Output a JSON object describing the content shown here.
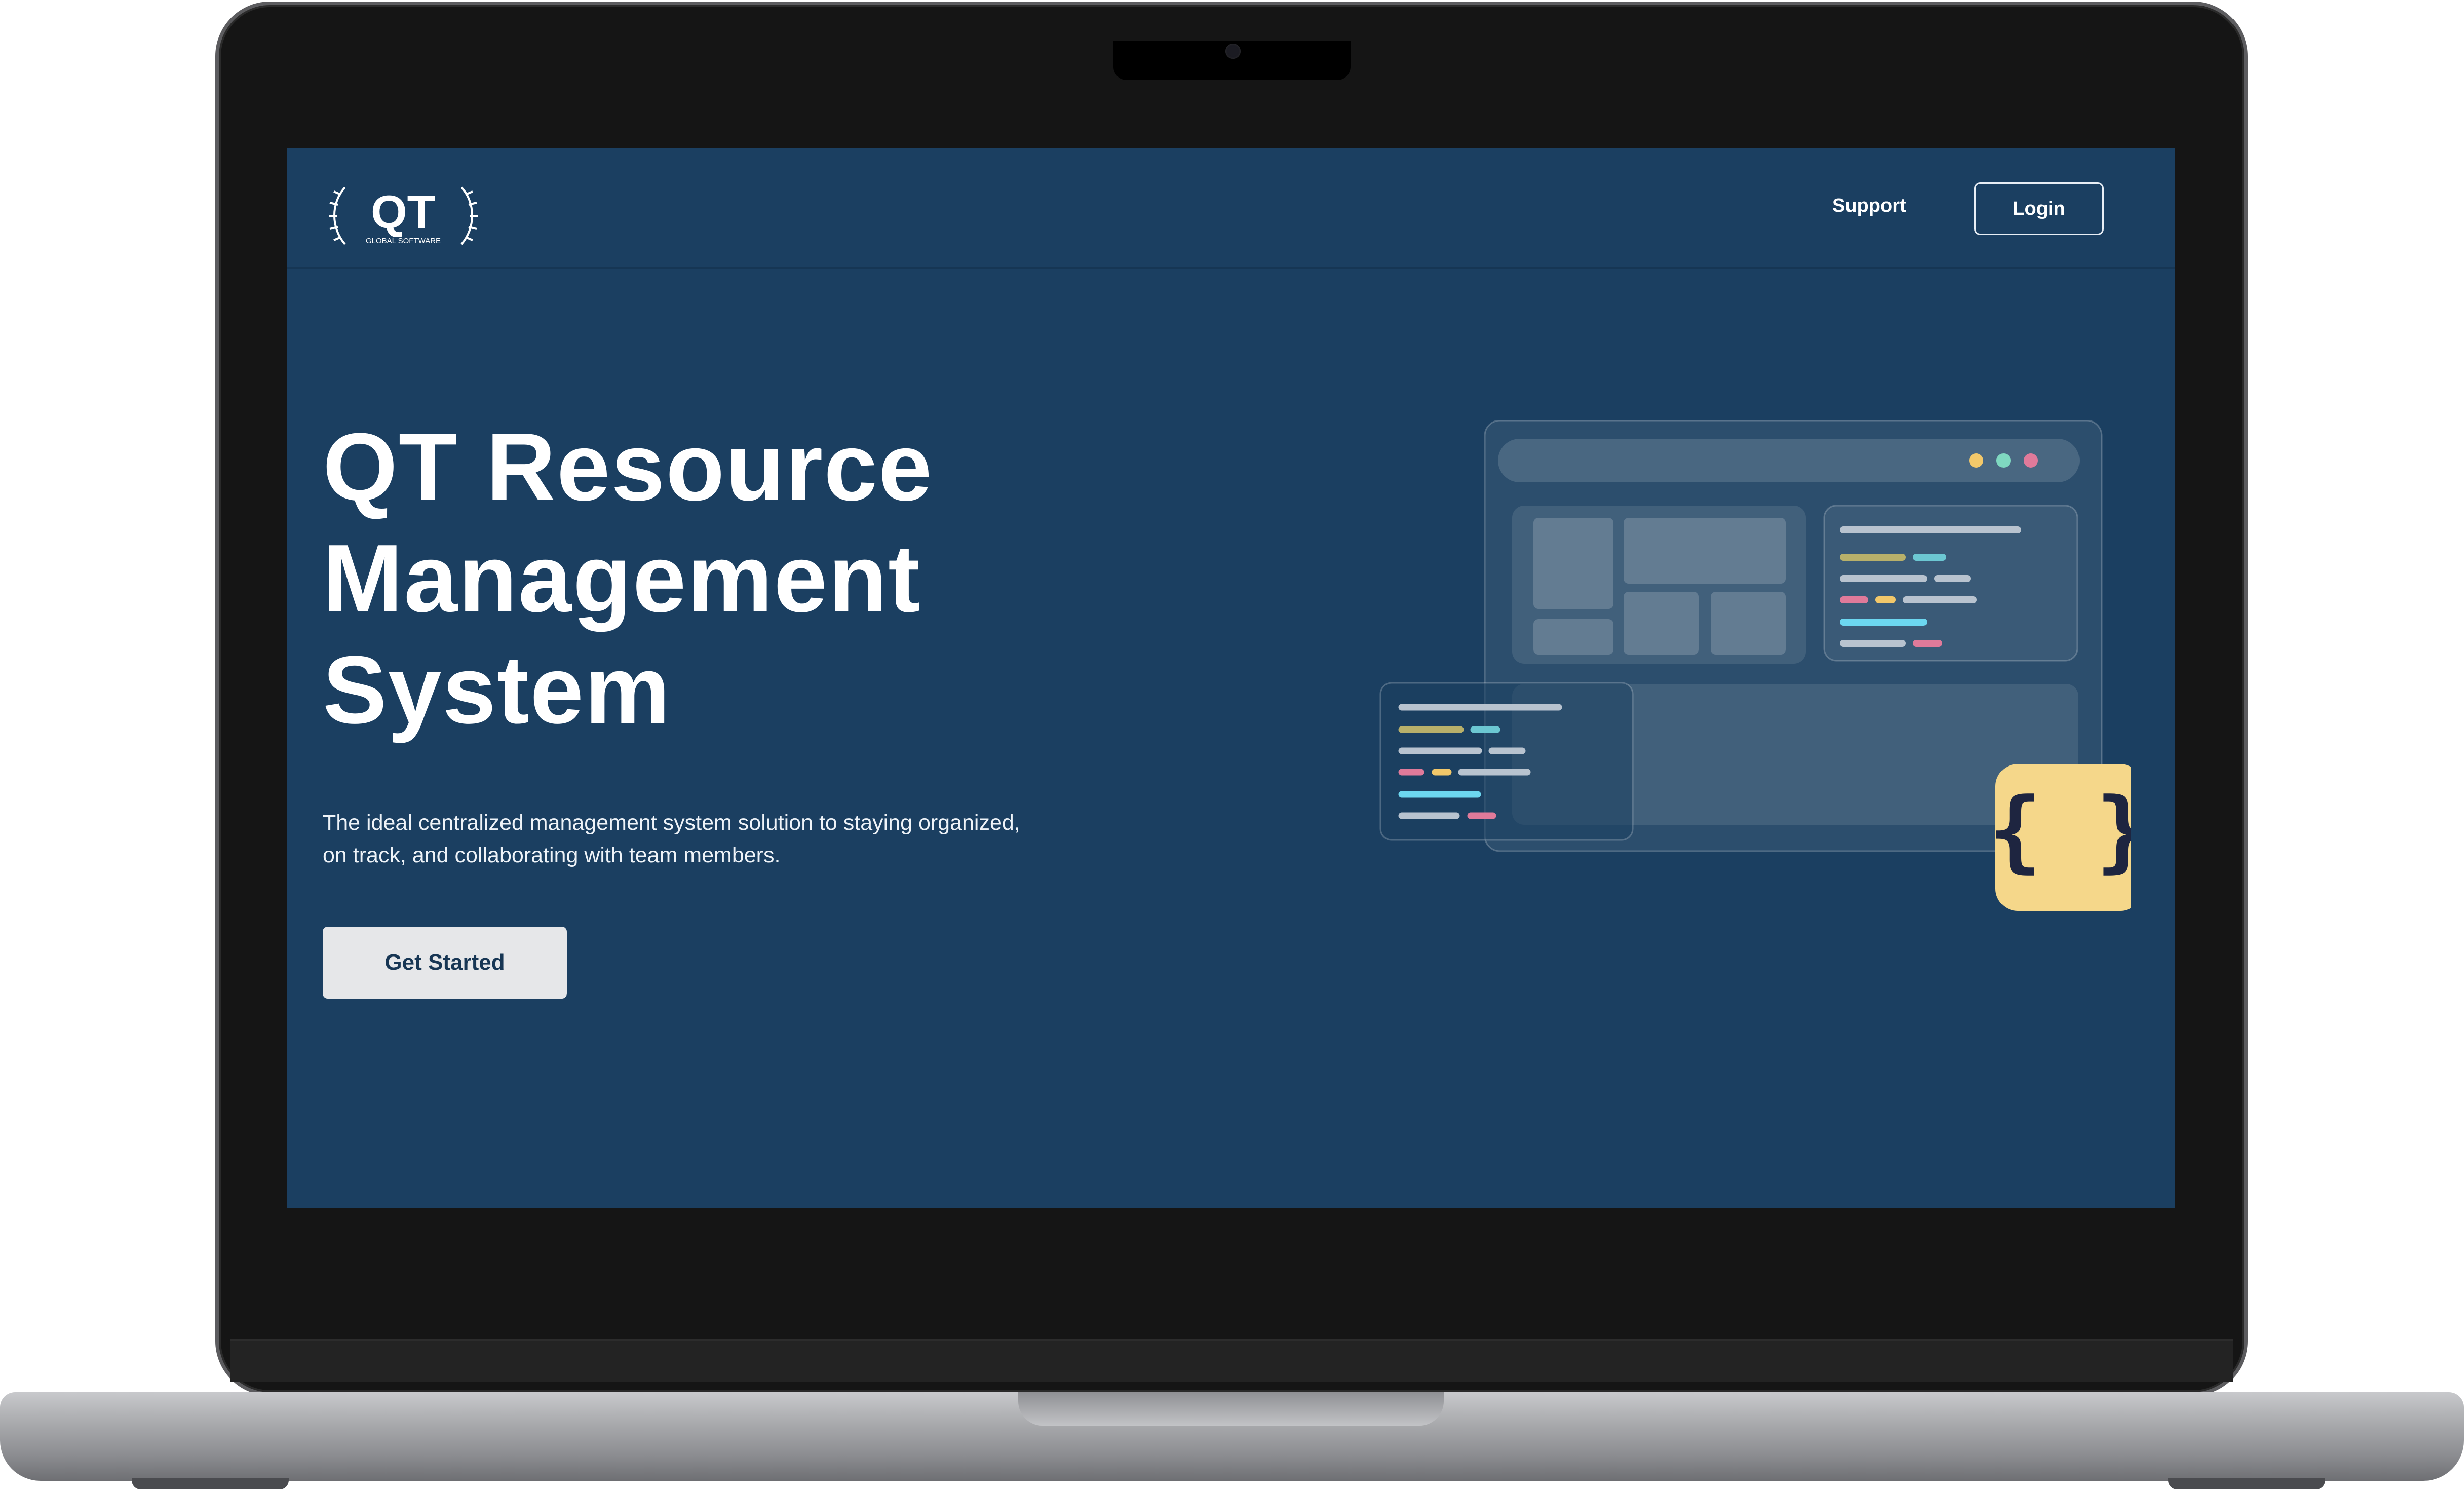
{
  "app": {
    "logo_text": "QT",
    "logo_subtext": "GLOBAL SOFTWARE"
  },
  "nav": {
    "support_label": "Support",
    "login_label": "Login"
  },
  "hero": {
    "title_lines": [
      "QT Resource",
      "Management",
      "System"
    ],
    "description": "The ideal centralized management system solution to staying organized, on track, and collaborating with team members.",
    "cta_label": "Get Started"
  },
  "illustration": {
    "code_badge": "{ }",
    "window_dots": [
      "#f2c86a",
      "#7fd8c0",
      "#e07a9a"
    ]
  },
  "colors": {
    "screen_bg": "#1b3f61",
    "badge_bg": "#f5d78a",
    "cta_bg": "#e6e7e9"
  }
}
